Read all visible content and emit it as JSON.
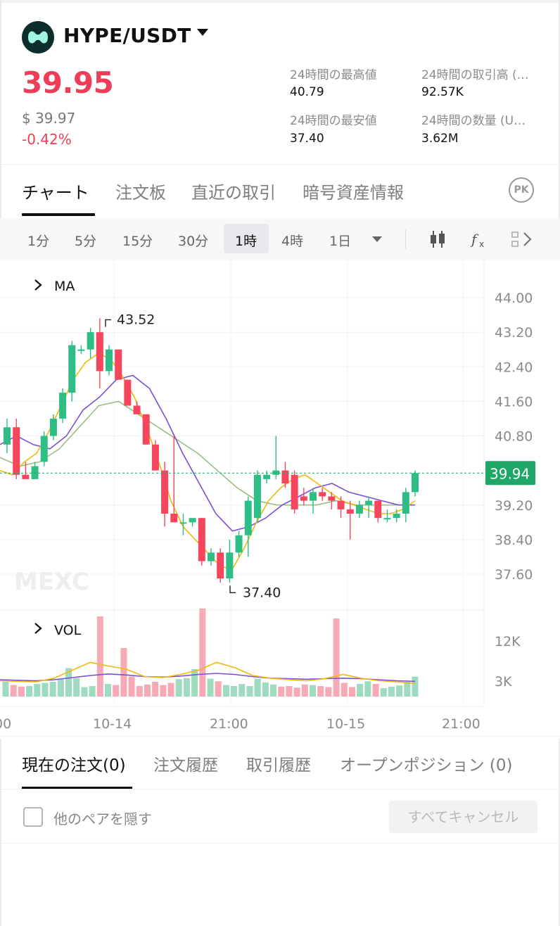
{
  "header": {
    "pair": "HYPE/USDT",
    "price": "39.95",
    "usd_price": "$ 39.97",
    "change": "-0.42%",
    "stats": [
      {
        "label": "24時間の最高値",
        "value": "40.79"
      },
      {
        "label": "24時間の取引高 (…",
        "value": "92.57K"
      },
      {
        "label": "24時間の最安値",
        "value": "37.40"
      },
      {
        "label": "24時間の数量 (U…",
        "value": "3.62M"
      }
    ]
  },
  "tabs": [
    "チャート",
    "注文板",
    "直近の取引",
    "暗号資産情報"
  ],
  "pk_label": "PK",
  "intervals": [
    "1分",
    "5分",
    "15分",
    "30分",
    "1時",
    "4時",
    "1日"
  ],
  "selected_interval": "1時",
  "chart_data": {
    "type": "candlestick",
    "indicator_label": "MA",
    "volume_label": "VOL",
    "watermark": "MEXC",
    "y_ticks": [
      "44.00",
      "43.20",
      "42.40",
      "41.60",
      "40.80",
      "39.20",
      "38.40",
      "37.60"
    ],
    "y_range": [
      37.0,
      44.3
    ],
    "current_price": "39.94",
    "current_price_value": 39.94,
    "high_annotation": "43.52",
    "high_value": 43.52,
    "low_annotation": "37.40",
    "low_value": 37.4,
    "x_ticks": [
      "00",
      "10-14",
      "21:00",
      "10-15",
      "21:00"
    ],
    "vol_ticks": [
      "12K",
      "3K"
    ],
    "vol_range": [
      0,
      16000
    ],
    "colors": {
      "up": "#2ebd85",
      "down": "#f6465d",
      "price_line": "#20b26c",
      "ma_fast": "#f0b90b",
      "ma_mid": "#7b4fd4",
      "ma_slow": "#9bbf83"
    },
    "candles": [
      {
        "o": 40.6,
        "h": 41.2,
        "l": 40.4,
        "c": 41.0
      },
      {
        "o": 41.0,
        "h": 41.2,
        "l": 39.8,
        "c": 39.9
      },
      {
        "o": 39.9,
        "h": 40.2,
        "l": 39.8,
        "c": 39.8
      },
      {
        "o": 39.8,
        "h": 40.2,
        "l": 39.8,
        "c": 40.1
      },
      {
        "o": 40.2,
        "h": 40.9,
        "l": 40.1,
        "c": 40.8
      },
      {
        "o": 40.8,
        "h": 41.3,
        "l": 40.7,
        "c": 41.2
      },
      {
        "o": 41.2,
        "h": 41.9,
        "l": 41.1,
        "c": 41.8
      },
      {
        "o": 41.8,
        "h": 43.0,
        "l": 41.6,
        "c": 42.9
      },
      {
        "o": 42.8,
        "h": 42.9,
        "l": 42.7,
        "c": 42.8
      },
      {
        "o": 42.8,
        "h": 43.3,
        "l": 42.6,
        "c": 43.2
      },
      {
        "o": 43.2,
        "h": 43.52,
        "l": 41.9,
        "c": 42.3
      },
      {
        "o": 42.3,
        "h": 42.9,
        "l": 42.2,
        "c": 42.8
      },
      {
        "o": 42.8,
        "h": 42.8,
        "l": 42.1,
        "c": 42.1
      },
      {
        "o": 42.1,
        "h": 42.1,
        "l": 41.5,
        "c": 41.5
      },
      {
        "o": 41.5,
        "h": 41.6,
        "l": 41.3,
        "c": 41.3
      },
      {
        "o": 41.3,
        "h": 41.3,
        "l": 40.6,
        "c": 40.6
      },
      {
        "o": 40.6,
        "h": 40.7,
        "l": 40.0,
        "c": 40.0
      },
      {
        "o": 40.0,
        "h": 40.2,
        "l": 38.7,
        "c": 39.0
      },
      {
        "o": 39.0,
        "h": 40.8,
        "l": 38.8,
        "c": 38.8
      },
      {
        "o": 38.8,
        "h": 39.0,
        "l": 38.5,
        "c": 38.8
      },
      {
        "o": 38.8,
        "h": 38.9,
        "l": 38.7,
        "c": 38.9
      },
      {
        "o": 38.9,
        "h": 38.9,
        "l": 37.8,
        "c": 37.9
      },
      {
        "o": 37.9,
        "h": 38.2,
        "l": 37.8,
        "c": 38.1
      },
      {
        "o": 38.1,
        "h": 38.2,
        "l": 37.4,
        "c": 37.5
      },
      {
        "o": 37.5,
        "h": 38.4,
        "l": 37.4,
        "c": 38.1
      },
      {
        "o": 38.1,
        "h": 38.6,
        "l": 38.0,
        "c": 38.5
      },
      {
        "o": 38.5,
        "h": 39.4,
        "l": 38.0,
        "c": 39.3
      },
      {
        "o": 38.9,
        "h": 40.0,
        "l": 38.8,
        "c": 39.9
      },
      {
        "o": 39.8,
        "h": 40.0,
        "l": 39.7,
        "c": 39.9
      },
      {
        "o": 39.9,
        "h": 40.8,
        "l": 39.8,
        "c": 40.0
      },
      {
        "o": 40.0,
        "h": 40.2,
        "l": 39.6,
        "c": 39.7
      },
      {
        "o": 39.9,
        "h": 40.0,
        "l": 39.0,
        "c": 39.1
      },
      {
        "o": 39.4,
        "h": 39.6,
        "l": 39.2,
        "c": 39.3
      },
      {
        "o": 39.3,
        "h": 39.6,
        "l": 39.0,
        "c": 39.5
      },
      {
        "o": 39.5,
        "h": 39.6,
        "l": 39.3,
        "c": 39.4
      },
      {
        "o": 39.4,
        "h": 39.5,
        "l": 39.1,
        "c": 39.3
      },
      {
        "o": 39.3,
        "h": 39.4,
        "l": 38.9,
        "c": 39.1
      },
      {
        "o": 39.1,
        "h": 39.3,
        "l": 38.4,
        "c": 39.0
      },
      {
        "o": 39.0,
        "h": 39.3,
        "l": 38.9,
        "c": 39.2
      },
      {
        "o": 39.2,
        "h": 39.4,
        "l": 38.9,
        "c": 39.3
      },
      {
        "o": 39.3,
        "h": 39.3,
        "l": 38.8,
        "c": 38.9
      },
      {
        "o": 38.9,
        "h": 39.1,
        "l": 38.8,
        "c": 38.9
      },
      {
        "o": 38.9,
        "h": 39.1,
        "l": 38.8,
        "c": 39.0
      },
      {
        "o": 39.0,
        "h": 39.6,
        "l": 38.8,
        "c": 39.5
      },
      {
        "o": 39.5,
        "h": 40.0,
        "l": 39.4,
        "c": 39.94
      }
    ],
    "volumes": [
      2800,
      2200,
      1900,
      2000,
      2400,
      2600,
      2800,
      3300,
      5400,
      3500,
      1800,
      2000,
      15200,
      2400,
      2200,
      9200,
      3800,
      2000,
      2300,
      2800,
      2200,
      2600,
      3300,
      3500,
      5200,
      16700,
      3400,
      2900,
      2200,
      2000,
      2400,
      2000,
      3400,
      2700,
      2300,
      1900,
      2000,
      1700,
      2300,
      2200,
      2000,
      1800,
      14800,
      2600,
      1800,
      2400,
      2900,
      2400,
      1600,
      1900,
      2100,
      2800,
      3800
    ],
    "ma_fast": [
      40.0,
      39.9,
      40.2,
      40.4,
      40.9,
      41.5,
      42.1,
      42.5,
      42.7,
      42.6,
      42.2,
      41.7,
      41.0,
      40.2,
      39.3,
      38.7,
      38.4,
      38.1,
      37.8,
      37.7,
      38.2,
      38.8,
      39.3,
      39.6,
      39.8,
      39.9,
      39.7,
      39.5,
      39.3,
      39.2,
      39.1,
      39.0,
      39.0,
      39.1,
      39.3
    ],
    "ma_mid": [
      40.6,
      40.8,
      40.6,
      40.5,
      40.8,
      41.4,
      41.7,
      42.1,
      42.2,
      41.9,
      41.2,
      40.4,
      39.7,
      39.0,
      38.6,
      38.7,
      38.9,
      39.2,
      39.4,
      39.6,
      39.7,
      39.5,
      39.4,
      39.3,
      39.2,
      39.2
    ],
    "ma_slow": [
      40.3,
      40.1,
      40.2,
      40.5,
      41.0,
      41.5,
      41.6,
      41.3,
      41.0,
      40.7,
      40.4,
      40.0,
      39.6,
      39.3,
      39.2,
      39.2,
      39.2,
      39.3,
      39.2,
      39.2,
      39.2,
      39.2
    ],
    "vol_ma_fast": [
      3000,
      2900,
      2800,
      3500,
      5000,
      6500,
      5800,
      5200,
      3800,
      3600,
      4200,
      5000,
      6500,
      5500,
      4000,
      3500,
      3200,
      3000,
      3400,
      4200,
      3500,
      3000,
      2800,
      2500
    ],
    "vol_ma_slow": [
      3200,
      3100,
      3000,
      3200,
      3600,
      4000,
      4300,
      4100,
      3800,
      3700,
      3900,
      4200,
      4400,
      4200,
      3800,
      3500,
      3400,
      3300,
      3400,
      3500,
      3400,
      3200,
      3000,
      2900
    ]
  },
  "order_tabs": [
    "現在の注文(0)",
    "注文履歴",
    "取引履歴",
    "オープンポジション (0)"
  ],
  "hide_pairs_label": "他のペアを隠す",
  "cancel_all_label": "すべてキャンセル"
}
